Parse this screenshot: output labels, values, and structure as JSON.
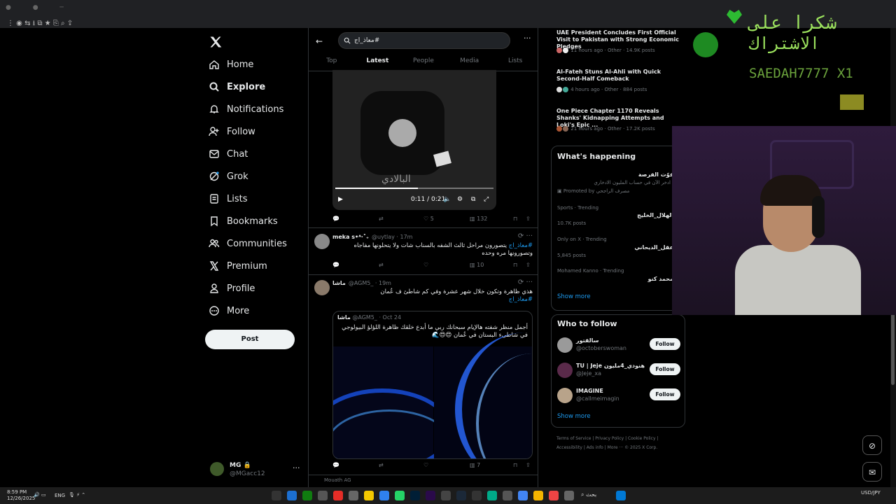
{
  "browser": {
    "toolbar_icons": [
      "back",
      "reload",
      "extensions",
      "download",
      "tab",
      "bookmark",
      "cast",
      "search",
      "share"
    ]
  },
  "nav": {
    "items": [
      {
        "label": "Home",
        "icon": "home-icon",
        "bold": false
      },
      {
        "label": "Explore",
        "icon": "search-icon",
        "bold": true
      },
      {
        "label": "Notifications",
        "icon": "bell-icon",
        "bold": false
      },
      {
        "label": "Follow",
        "icon": "person-plus-icon",
        "bold": false
      },
      {
        "label": "Chat",
        "icon": "mail-icon",
        "bold": false
      },
      {
        "label": "Grok",
        "icon": "grok-icon",
        "bold": false
      },
      {
        "label": "Lists",
        "icon": "list-icon",
        "bold": false
      },
      {
        "label": "Bookmarks",
        "icon": "bookmark-icon",
        "bold": false
      },
      {
        "label": "Communities",
        "icon": "people-icon",
        "bold": false
      },
      {
        "label": "Premium",
        "icon": "x-icon",
        "bold": false
      },
      {
        "label": "Profile",
        "icon": "person-icon",
        "bold": false
      },
      {
        "label": "More",
        "icon": "more-circle-icon",
        "bold": false
      }
    ],
    "post_label": "Post"
  },
  "account": {
    "name": "MG 🔒",
    "handle": "@MGacc12"
  },
  "search": {
    "query": "#معاذ_اج"
  },
  "tabs": [
    "Top",
    "Latest",
    "People",
    "Media",
    "Lists"
  ],
  "video": {
    "time": "0:11 / 0:21",
    "progress": 0.52,
    "caption": "البالادي",
    "replies": "",
    "retweets": "",
    "likes": "5",
    "views": "132"
  },
  "tweets": [
    {
      "name": "meka ꜱ•ᴬ‧˚₊",
      "handle": "@uytlay",
      "time": "17m",
      "tag": "#معاذ_اج",
      "text": "يتصورون مراحل ثالث الشفه بالسناب شات ولا يتحلونها مفاجاه وتصورونها مره وحده",
      "views": "10"
    },
    {
      "name": "ماشا",
      "handle": "@AGM5_",
      "time": "19m",
      "text": "هذي ظاهرة وتكون خلال شهر عشرة وفي كم شاطئ ف عُمان",
      "tag": "#معاذ_اج",
      "views": "7",
      "quote": {
        "name": "ماشا",
        "handle": "@AGM5_",
        "time": "Oct 24",
        "text": "أجمل منظر شفته هالإيام سبحانك ربي ما أبدع خلقك ظاهرة اللؤلؤ البيولوجي في شاطىء البستان في عُمان 😍😍🌊"
      }
    }
  ],
  "next_tweet_name": "Mouath AG",
  "trends_top": [
    {
      "title": "UAE President Concludes First Official Visit to Pakistan with Strong Economic Pledges",
      "meta": "11 hours ago · Other · 14.9K posts"
    },
    {
      "title": "Al-Fateh Stuns Al-Ahli with Quick Second-Half Comeback",
      "meta": "4 hours ago · Other · 884 posts"
    },
    {
      "title": "One Piece Chapter 1170 Reveals Shanks' Kidnapping Attempts and Loki's Epic ...",
      "meta": "21 hours ago · Other · 17.2K posts"
    }
  ],
  "happening": {
    "title": "What's happening",
    "promo": {
      "name": "فوّت الفرصة",
      "text": "ادخر الآن في حساب المليون الادخاري",
      "by": "Promoted by مصرف الراجحي"
    },
    "items": [
      {
        "cat": "Sports · Trending",
        "name": "الهلال_الخليج",
        "posts": "10.7K posts"
      },
      {
        "cat": "Only on X · Trending",
        "name": "عقل_الديحاني",
        "posts": "5,845 posts"
      },
      {
        "cat": "Mohamed Kanno · Trending",
        "name": "محمد كنو",
        "posts": ""
      }
    ],
    "show_more": "Show more"
  },
  "who": {
    "title": "Who to follow",
    "users": [
      {
        "name": "سالقتور",
        "handle": "@octoberswoman",
        "btn": "Follow"
      },
      {
        "name": "TU | Jeje هنودي_4مليون",
        "handle": "@Jeje_xa",
        "btn": "Follow"
      },
      {
        "name": "IMAGINE",
        "handle": "@callmeimagin",
        "btn": "Follow"
      }
    ],
    "show_more": "Show more"
  },
  "footer": "Terms of Service | Privacy Policy | Cookie Policy | Accessibility | Ads info | More ··· © 2025 X Corp.",
  "overlay": {
    "line1": "شكرا على",
    "line2": "الاشتراك",
    "user": "SAEDAH7777 X1"
  },
  "taskbar": {
    "time": "8:59 PM",
    "date": "12/26/2025",
    "lang": "ENG",
    "search": "بحث",
    "currency": "USD/JPY"
  }
}
